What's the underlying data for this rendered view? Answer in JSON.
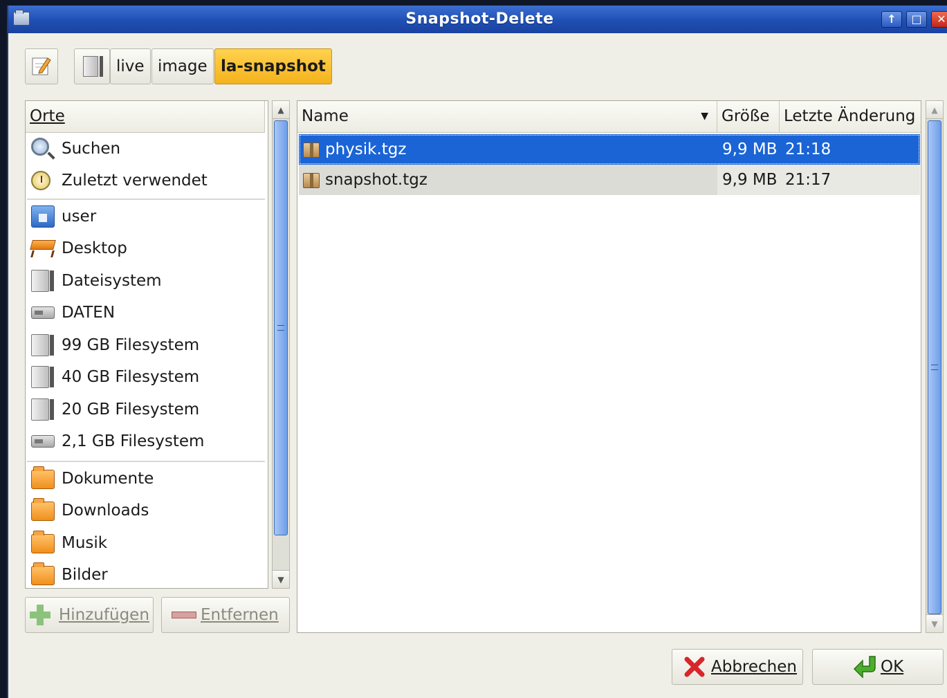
{
  "window": {
    "title": "Snapshot-Delete"
  },
  "path_bar": {
    "crumbs": [
      "live",
      "image",
      "la-snapshot"
    ],
    "active_index": 2
  },
  "places": {
    "header": "Orte",
    "items": [
      {
        "label": "Suchen",
        "icon": "search-icon"
      },
      {
        "label": "Zuletzt verwendet",
        "icon": "clock-icon"
      },
      {
        "label": "user",
        "icon": "home-folder-icon"
      },
      {
        "label": "Desktop",
        "icon": "desktop-icon"
      },
      {
        "label": "Dateisystem",
        "icon": "drive-icon"
      },
      {
        "label": "DATEN",
        "icon": "harddisk-icon"
      },
      {
        "label": "99 GB Filesystem",
        "icon": "drive-icon"
      },
      {
        "label": "40 GB Filesystem",
        "icon": "drive-icon"
      },
      {
        "label": "20 GB Filesystem",
        "icon": "drive-icon"
      },
      {
        "label": "2,1 GB Filesystem",
        "icon": "harddisk-icon"
      },
      {
        "label": "Dokumente",
        "icon": "folder-icon"
      },
      {
        "label": "Downloads",
        "icon": "folder-icon"
      },
      {
        "label": "Musik",
        "icon": "folder-icon"
      },
      {
        "label": "Bilder",
        "icon": "folder-icon"
      }
    ],
    "add_label": "Hinzufügen",
    "remove_label": "Entfernen"
  },
  "files": {
    "columns": {
      "name": "Name",
      "size": "Größe",
      "modified": "Letzte Änderung"
    },
    "rows": [
      {
        "name": "physik.tgz",
        "size": "9,9 MB",
        "modified": "21:18",
        "selected": true
      },
      {
        "name": "snapshot.tgz",
        "size": "9,9 MB",
        "modified": "21:17",
        "selected": false
      }
    ]
  },
  "actions": {
    "cancel_label": "Abbrechen",
    "ok_label": "OK"
  },
  "colors": {
    "selection": "#1a64d6",
    "active_crumb": "#f7bd2e",
    "titlebar": "#1f4fb4"
  }
}
